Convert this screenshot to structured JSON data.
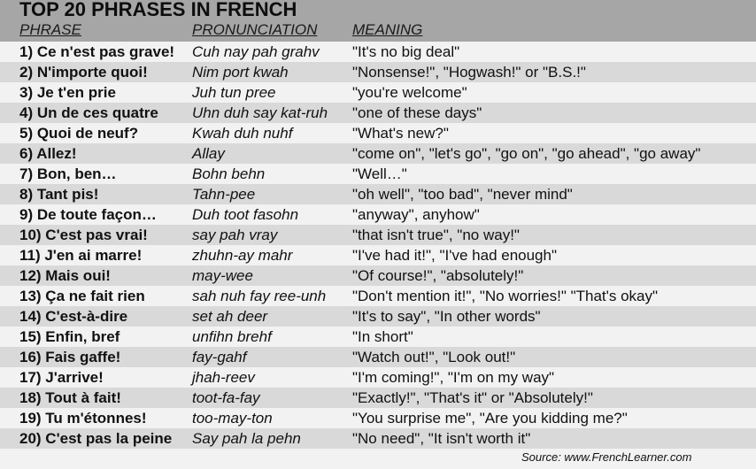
{
  "title": "TOP 20 PHRASES IN FRENCH",
  "columns": {
    "phrase": "PHRASE",
    "pronunciation": "PRONUNCIATION",
    "meaning": "MEANING"
  },
  "colors": {
    "header_bg": "#a6a6a6",
    "row_light": "#f2f2f2",
    "row_dark": "#d9d9d9"
  },
  "rows": [
    {
      "phrase": "1) Ce n'est pas grave!",
      "pronunciation": "Cuh nay pah grahv",
      "meaning": "\"It's no big deal\""
    },
    {
      "phrase": "2) N'importe quoi!",
      "pronunciation": "Nim port kwah",
      "meaning": "\"Nonsense!\", \"Hogwash!\" or \"B.S.!\""
    },
    {
      "phrase": "3) Je t'en prie",
      "pronunciation": "Juh tun pree",
      "meaning": "\"you're welcome\""
    },
    {
      "phrase": "4) Un de ces quatre",
      "pronunciation": "Uhn duh say kat-ruh",
      "meaning": "\"one of these days\""
    },
    {
      "phrase": "5) Quoi de neuf?",
      "pronunciation": "Kwah duh nuhf",
      "meaning": "\"What's new?\""
    },
    {
      "phrase": "6) Allez!",
      "pronunciation": "Allay",
      "meaning": "\"come on\", \"let's go\", \"go on\", \"go ahead\", \"go away\""
    },
    {
      "phrase": "7) Bon, ben…",
      "pronunciation": "Bohn behn",
      "meaning": "\"Well…\""
    },
    {
      "phrase": "8) Tant pis!",
      "pronunciation": "Tahn-pee",
      "meaning": "\"oh well\", \"too bad\", \"never mind\""
    },
    {
      "phrase": "9) De toute façon…",
      "pronunciation": "Duh toot fasohn",
      "meaning": "\"anyway\", anyhow\""
    },
    {
      "phrase": "10) C'est pas vrai!",
      "pronunciation": "say pah vray",
      "meaning": "\"that isn't true\", \"no way!\""
    },
    {
      "phrase": "11) J'en ai marre!",
      "pronunciation": "zhuhn-ay mahr",
      "meaning": "\"I've had it!\", \"I've had enough\""
    },
    {
      "phrase": "12) Mais oui!",
      "pronunciation": "may-wee",
      "meaning": "\"Of course!\", \"absolutely!\""
    },
    {
      "phrase": "13) Ça ne fait rien",
      "pronunciation": "sah nuh fay ree-unh",
      "meaning": "\"Don't mention it!\", \"No worries!\" \"That's okay\""
    },
    {
      "phrase": "14) C'est-à-dire",
      "pronunciation": "set ah deer",
      "meaning": "\"It's to say\", \"In other words\""
    },
    {
      "phrase": "15) Enfin, bref",
      "pronunciation": "unfihn brehf",
      "meaning": "\"In short\""
    },
    {
      "phrase": "16) Fais gaffe!",
      "pronunciation": "fay-gahf",
      "meaning": "\"Watch out!\",  \"Look out!\""
    },
    {
      "phrase": "17) J'arrive!",
      "pronunciation": "jhah-reev",
      "meaning": "\"I'm coming!\", \"I'm on my way\""
    },
    {
      "phrase": "18) Tout à fait!",
      "pronunciation": "toot-fa-fay",
      "meaning": "\"Exactly!\", \"That's it\" or \"Absolutely!\""
    },
    {
      "phrase": "19) Tu m'étonnes!",
      "pronunciation": "too-may-ton",
      "meaning": "\"You surprise me\", \"Are you kidding me?\""
    },
    {
      "phrase": "20) C'est pas la peine",
      "pronunciation": "Say pah la pehn",
      "meaning": "\"No need\", \"It isn't worth it\""
    }
  ],
  "source": "Source: www.FrenchLearner.com"
}
